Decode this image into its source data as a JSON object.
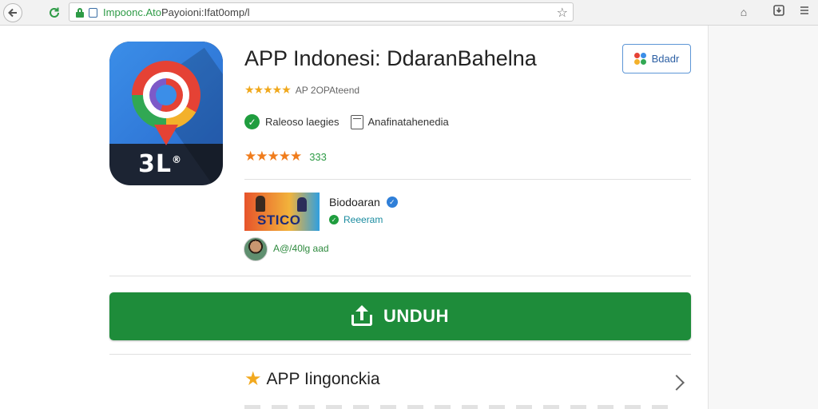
{
  "browser": {
    "url_green": "Impoonc.Ato",
    "url_rest": "Payoioni:Ifat0omp/l"
  },
  "app": {
    "title": "APP Indonesi: DdaranBahelna",
    "icon_label": "3L",
    "icon_label_sup": "®",
    "meta_stars": "★★★★★",
    "meta_text": "AP 2OPAteend",
    "badge1": "Raleoso laegies",
    "badge2": "Anafinatahenedia",
    "rating_stars": "★★★★★",
    "rating_value": "333",
    "share_label": "Bdadr"
  },
  "developer": {
    "banner_text": "STICO",
    "name": "Biodoaran",
    "status": "Reeeram",
    "review_text": "A@/40lg aad"
  },
  "actions": {
    "download_label": "UNDUH"
  },
  "section": {
    "title": "APP Iingonckia"
  },
  "colors": {
    "download": "#1e8c3a",
    "accent_blue": "#2f7fd8",
    "star_orange": "#f07c1c"
  }
}
